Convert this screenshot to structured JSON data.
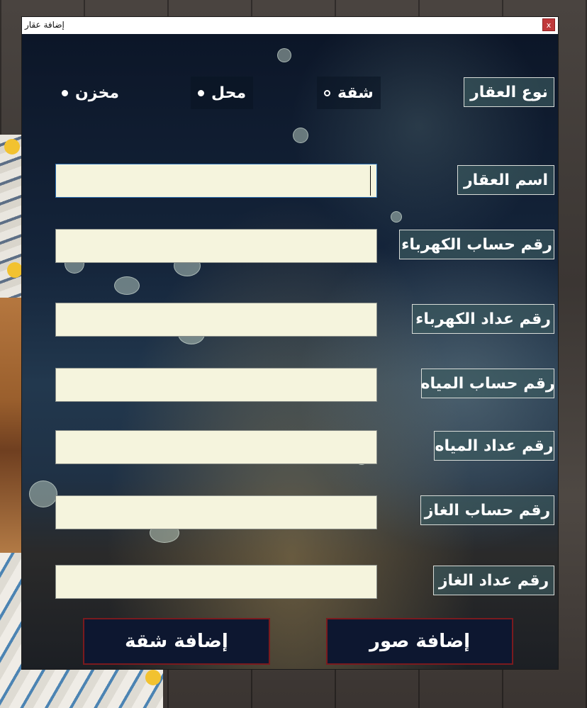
{
  "window": {
    "title": "إضافة عقار",
    "close_label": "x"
  },
  "property_type": {
    "label": "نوع العقار",
    "options": [
      {
        "label": "شقة",
        "state": "unchecked"
      },
      {
        "label": "محل",
        "state": "filled"
      },
      {
        "label": "مخزن",
        "state": "filled"
      }
    ]
  },
  "fields": {
    "property_name": {
      "label": "اسم العقار",
      "value": ""
    },
    "electricity_account": {
      "label": "رقم حساب الكهرباء",
      "value": ""
    },
    "electricity_meter": {
      "label": "رقم عداد الكهرباء",
      "value": ""
    },
    "water_account": {
      "label": "رقم حساب المياه",
      "value": ""
    },
    "water_meter": {
      "label": "رقم عداد المياه",
      "value": ""
    },
    "gas_account": {
      "label": "رقم حساب الغاز",
      "value": ""
    },
    "gas_meter": {
      "label": "رقم عداد الغاز",
      "value": ""
    }
  },
  "buttons": {
    "add_apartment": "إضافة شقة",
    "add_photos": "إضافة صور"
  },
  "colors": {
    "input_bg": "#f5f4dd",
    "button_border": "#7a1a1e",
    "close_button": "#c0393b"
  }
}
